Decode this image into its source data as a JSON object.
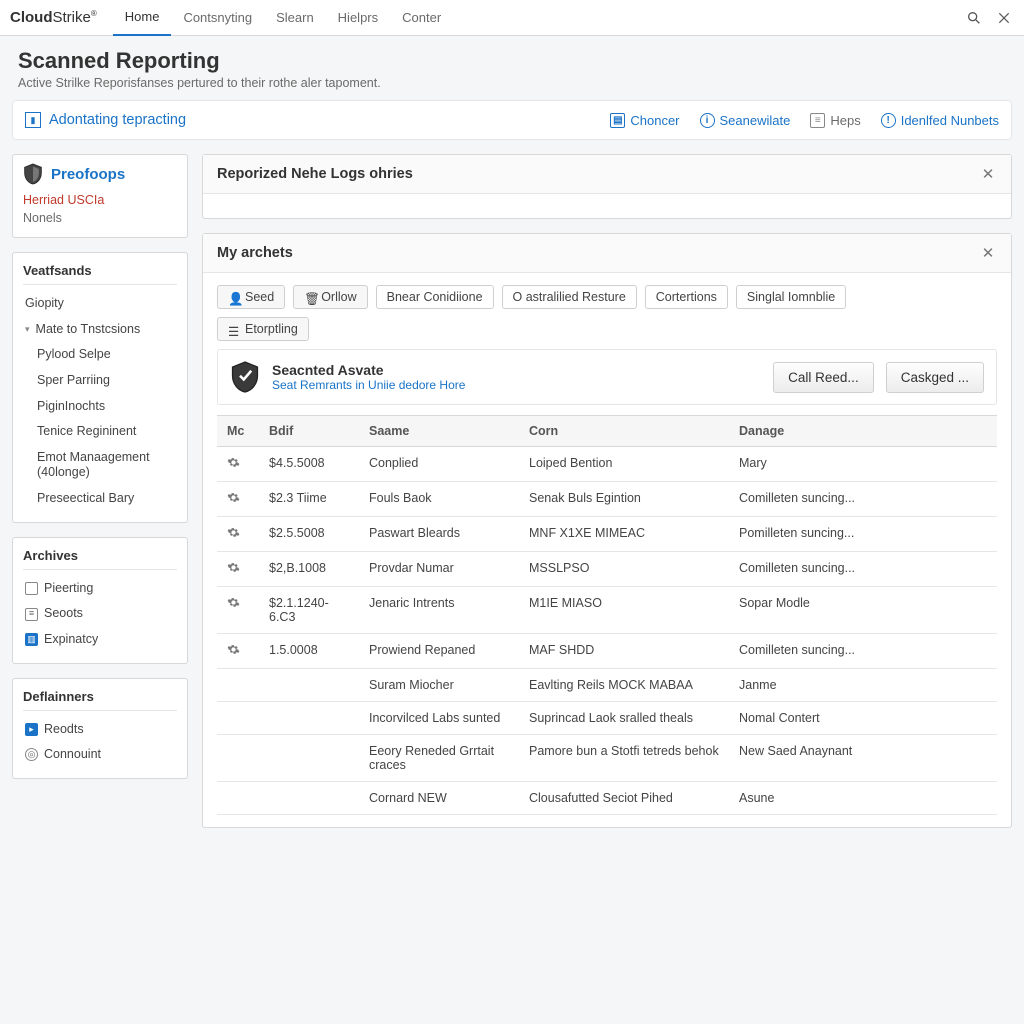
{
  "brand": {
    "bold": "Cloud",
    "rest": "Strike"
  },
  "topnav": {
    "tabs": [
      "Home",
      "Contsnyting",
      "Slearn",
      "Hielprs",
      "Conter"
    ],
    "activeIndex": 0
  },
  "page": {
    "title": "Scanned Reporting",
    "subtitle": "Active Strilke Reporisfanses pertured to their rothe aler tapoment."
  },
  "strip": {
    "leftLabel": "Adontating tepracting",
    "links": [
      {
        "icon": "choncer-icon",
        "label": "Choncer",
        "muted": false,
        "shape": "square"
      },
      {
        "icon": "info-icon",
        "label": "Seanewilate",
        "muted": false,
        "shape": "circle"
      },
      {
        "icon": "heps-icon",
        "label": "Heps",
        "muted": true,
        "shape": "square"
      },
      {
        "icon": "numbers-icon",
        "label": "Idenlfed Nunbets",
        "muted": false,
        "shape": "circle"
      }
    ]
  },
  "sidebar": {
    "brand": "Preofoops",
    "brandSub1": "Herriad USCIa",
    "brandSub2": "Nonels",
    "groups": [
      {
        "head": "Veatfsands",
        "items": [
          {
            "label": "Giopity"
          },
          {
            "label": "Mate to Tnstcsions",
            "expandable": true
          },
          {
            "label": "Pylood Selpe",
            "child": true
          },
          {
            "label": "Sper Parriing",
            "child": true
          },
          {
            "label": "PiginInochts",
            "child": true
          },
          {
            "label": "Tenice Regininent",
            "child": true
          },
          {
            "label": "Emot Manaagement (40longe)",
            "child": true
          },
          {
            "label": "Preseectical Bary",
            "child": true
          }
        ]
      },
      {
        "head": "Archives",
        "items": [
          {
            "label": "Pieerting",
            "icon": "doc-icon"
          },
          {
            "label": "Seoots",
            "icon": "doc-icon"
          },
          {
            "label": "Expinatcy",
            "icon": "folder-icon",
            "blue": true
          }
        ]
      },
      {
        "head": "Deflainners",
        "items": [
          {
            "label": "Reodts",
            "icon": "badge-icon",
            "blue": true
          },
          {
            "label": "Connouint",
            "icon": "target-icon"
          }
        ]
      }
    ]
  },
  "panelA": {
    "title": "Reporized Nehe Logs ohries"
  },
  "panelB": {
    "title": "My archets",
    "buttons": [
      {
        "label": "Seed",
        "icon": "user-icon"
      },
      {
        "label": "Orllow",
        "icon": "trash-icon"
      },
      {
        "label": "Bnear Conidiione"
      },
      {
        "label": "O astralilied Resture"
      },
      {
        "label": "Cortertions"
      },
      {
        "label": "Singlal Iomnblie"
      }
    ],
    "buttons2": [
      {
        "label": "Etorptling",
        "icon": "list-icon"
      }
    ],
    "callout": {
      "t1": "Seacnted Asvate",
      "t2": "Seat Remrants in Uniie dedore Hore",
      "btn1": "Call Reed...",
      "btn2": "Caskged ..."
    },
    "columns": [
      "Mc",
      "Bdif",
      "Saame",
      "Corn",
      "Danage"
    ],
    "rows": [
      {
        "gear": true,
        "bdif": "$4.5.5008",
        "saame": "Conplied",
        "corn": "Loiped Bention",
        "danage": "Mary"
      },
      {
        "gear": true,
        "bdif": "$2.3 Tiime",
        "saame": "Fouls Baok",
        "corn": "Senak Buls Egintion",
        "danage": "Comilleten suncing..."
      },
      {
        "gear": true,
        "bdif": "$2.5.5008",
        "saame": "Paswart Bleards",
        "corn": "MNF X1XE MIMEAC",
        "danage": "Pomilleten suncing..."
      },
      {
        "gear": true,
        "bdif": "$2,B.1008",
        "saame": "Provdar Numar",
        "corn": "MSSLPSO",
        "danage": "Comilleten suncing..."
      },
      {
        "gear": true,
        "bdif": "$2.1.1240-6.C3",
        "saame": "Jenaric Intrents",
        "corn": "M1IE MIASO",
        "danage": "Sopar Modle"
      },
      {
        "gear": true,
        "bdif": "1.5.0008",
        "saame": "Prowiend Repaned",
        "corn": "MAF SHDD",
        "danage": "Comilleten suncing..."
      },
      {
        "gear": false,
        "bdif": "",
        "saame": "Suram Miocher",
        "corn": "Eavlting Reils MOCK MABAA",
        "danage": "Janme"
      },
      {
        "gear": false,
        "bdif": "",
        "saame": "Incorvilced Labs sunted",
        "corn": "Suprincad Laok sralled theals",
        "danage": "Nomal Contert"
      },
      {
        "gear": false,
        "bdif": "",
        "saame": "Eeory Reneded Grrtait craces",
        "corn": "Pamore bun a Stotfi tetreds behok",
        "danage": "New Saed Anaynant"
      },
      {
        "gear": false,
        "bdif": "",
        "saame": "Cornard NEW",
        "corn": "Clousafutted Seciot Pihed",
        "danage": "Asune"
      }
    ]
  }
}
